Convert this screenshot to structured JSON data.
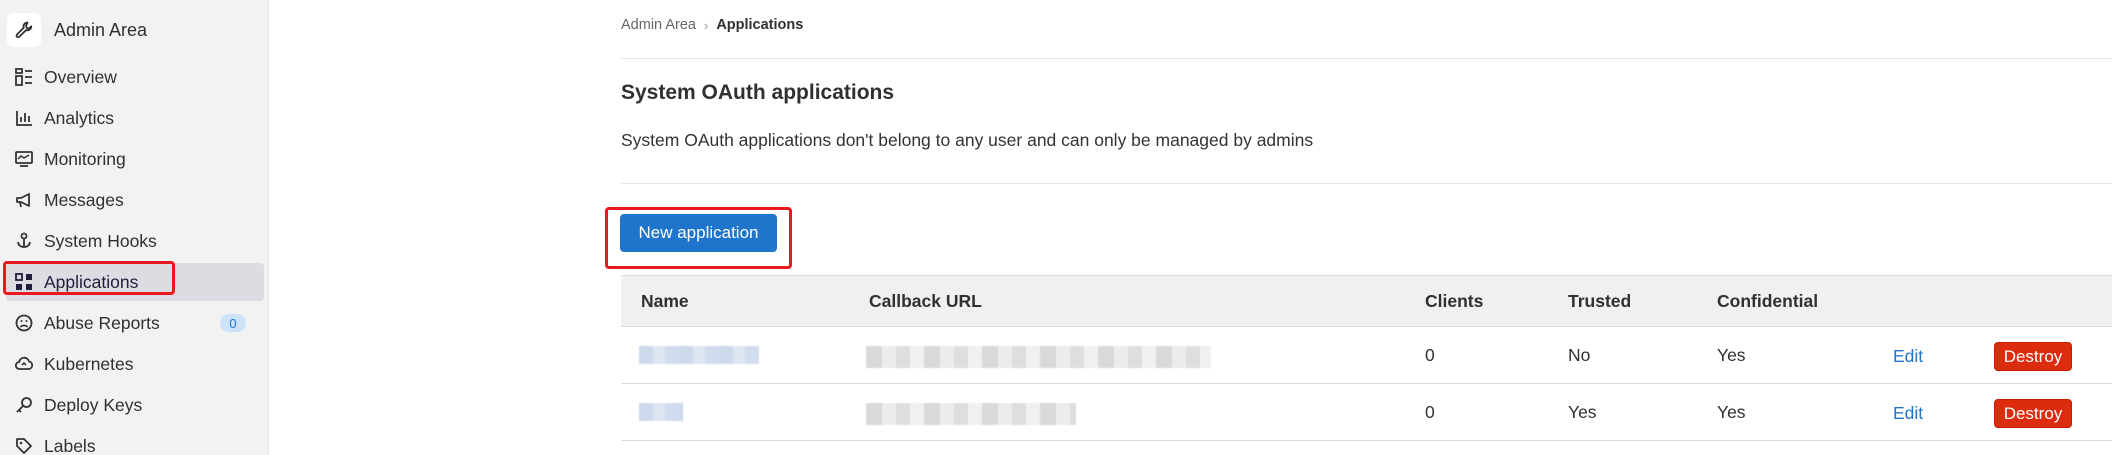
{
  "sidebar": {
    "title": "Admin Area",
    "logo_icon": "wrench-icon",
    "items": [
      {
        "label": "Overview",
        "icon": "overview-icon"
      },
      {
        "label": "Analytics",
        "icon": "analytics-icon"
      },
      {
        "label": "Monitoring",
        "icon": "monitor-icon"
      },
      {
        "label": "Messages",
        "icon": "megaphone-icon"
      },
      {
        "label": "System Hooks",
        "icon": "hook-icon"
      },
      {
        "label": "Applications",
        "icon": "applications-icon",
        "active": true
      },
      {
        "label": "Abuse Reports",
        "icon": "abuse-icon",
        "badge": "0"
      },
      {
        "label": "Kubernetes",
        "icon": "cloud-icon"
      },
      {
        "label": "Deploy Keys",
        "icon": "key-icon"
      },
      {
        "label": "Labels",
        "icon": "label-icon"
      }
    ]
  },
  "breadcrumb": {
    "parent": "Admin Area",
    "current": "Applications"
  },
  "page": {
    "title": "System OAuth applications",
    "description": "System OAuth applications don't belong to any user and can only be managed by admins",
    "new_button": "New application"
  },
  "table": {
    "headers": {
      "name": "Name",
      "callback": "Callback URL",
      "clients": "Clients",
      "trusted": "Trusted",
      "confidential": "Confidential"
    },
    "rows": [
      {
        "clients": "0",
        "trusted": "No",
        "confidential": "Yes",
        "edit": "Edit",
        "destroy": "Destroy"
      },
      {
        "clients": "0",
        "trusted": "Yes",
        "confidential": "Yes",
        "edit": "Edit",
        "destroy": "Destroy"
      }
    ]
  },
  "colors": {
    "primary": "#1f75cb",
    "danger": "#dd2b0e",
    "highlight": "#e8191f"
  }
}
